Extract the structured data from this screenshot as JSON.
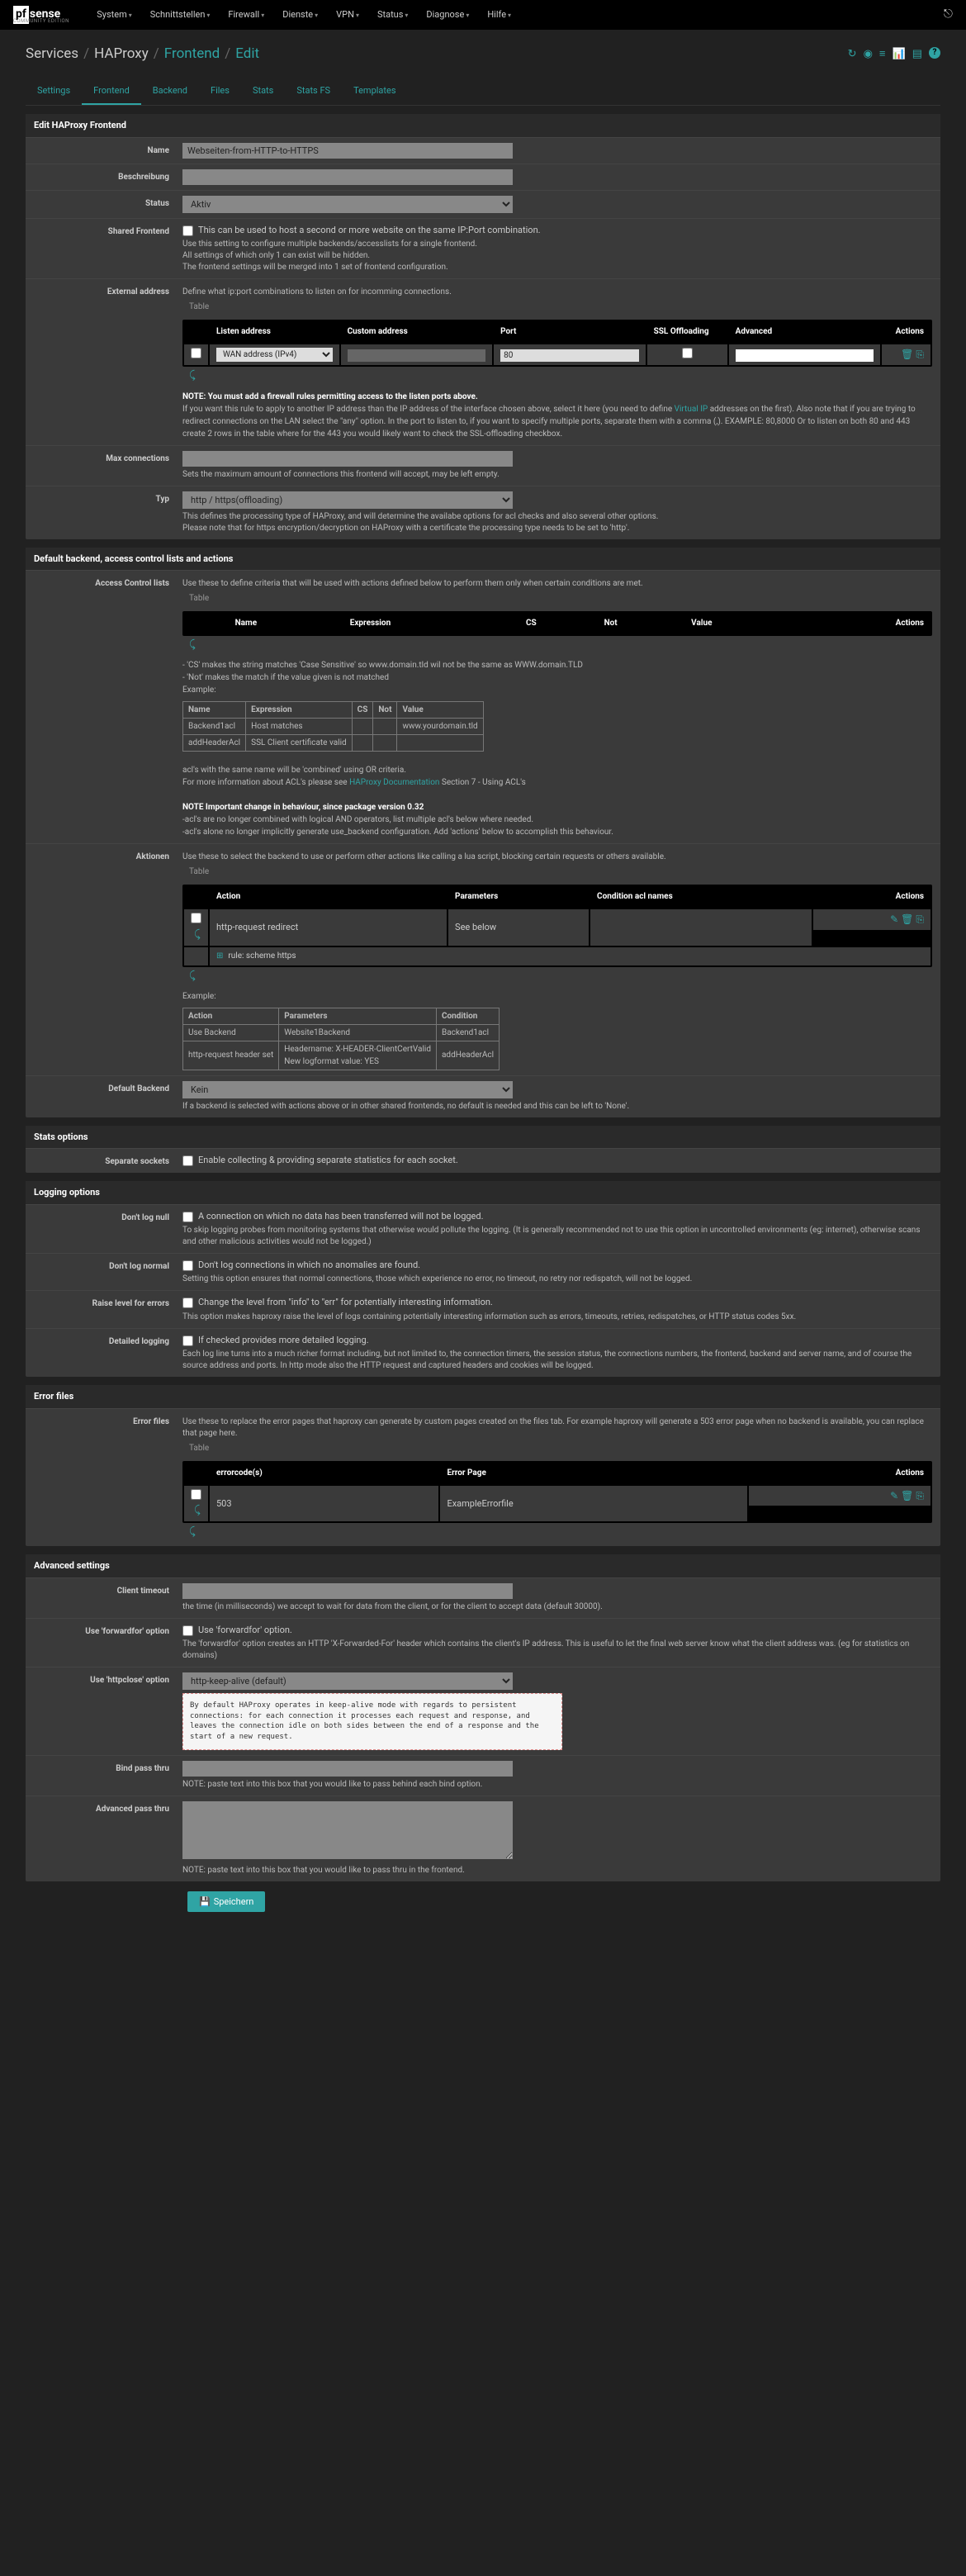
{
  "brand": "sense",
  "comm": "COMMUNITY EDITION",
  "topmenu": [
    "System",
    "Schnittstellen",
    "Firewall",
    "Dienste",
    "VPN",
    "Status",
    "Diagnose",
    "Hilfe"
  ],
  "bc": {
    "s": "Services",
    "h": "HAProxy",
    "f": "Frontend",
    "e": "Edit"
  },
  "tabs": [
    "Settings",
    "Frontend",
    "Backend",
    "Files",
    "Stats",
    "Stats FS",
    "Templates"
  ],
  "p1": {
    "title": "Edit HAProxy Frontend",
    "name": {
      "l": "Name",
      "v": "Webseiten-from-HTTP-to-HTTPS"
    },
    "desc": {
      "l": "Beschreibung",
      "v": ""
    },
    "status": {
      "l": "Status",
      "v": "Aktiv"
    },
    "shared": {
      "l": "Shared Frontend",
      "c": "This can be used to host a second or more website on the same IP:Port combination.",
      "h": "Use this setting to configure multiple backends/accesslists for a single frontend.\nAll settings of which only 1 can exist will be hidden.\nThe frontend settings will be merged into 1 set of frontend configuration."
    },
    "ext": {
      "l": "External address",
      "h1": "Define what ip:port combinations to listen on for incomming connections.",
      "tbl": "Table",
      "th": [
        "Listen address",
        "Custom address",
        "Port",
        "SSL Offloading",
        "Advanced",
        "Actions"
      ],
      "row": {
        "listen": "WAN address (IPv4)",
        "port": "80"
      },
      "note": "NOTE: You must add a firewall rules permitting access to the listen ports above.",
      "note2": "If you want this rule to apply to another IP address than the IP address of the interface chosen above, select it here (you need to define ",
      "vip": "Virtual IP",
      "note3": " addresses on the first). Also note that if you are trying to redirect connections on the LAN select the \"any\" option. In the port to listen to, if you want to specify multiple ports, separate them with a comma (,). EXAMPLE: 80,8000 Or to listen on both 80 and 443 create 2 rows in the table where for the 443 you would likely want to check the SSL-offloading checkbox."
    },
    "max": {
      "l": "Max connections",
      "h": "Sets the maximum amount of connections this frontend will accept, may be left empty."
    },
    "typ": {
      "l": "Typ",
      "v": "http / https(offloading)",
      "h": "This defines the processing type of HAProxy, and will determine the availabe options for acl checks and also several other options.\nPlease note that for https encryption/decryption on HAProxy with a certificate the processing type needs to be set to 'http'."
    }
  },
  "p2": {
    "title": "Default backend, access control lists and actions",
    "acl": {
      "l": "Access Control lists",
      "h1": "Use these to define criteria that will be used with actions defined below to perform them only when certain conditions are met.",
      "tbl": "Table",
      "th": [
        "Name",
        "Expression",
        "CS",
        "Not",
        "Value",
        "Actions"
      ],
      "n1": "- 'CS' makes the string matches 'Case Sensitive' so www.domain.tld wil not be the same as WWW.domain.TLD",
      "n2": "- 'Not' makes the match if the value given is not matched",
      "exl": "Example:",
      "ex": {
        "th": [
          "Name",
          "Expression",
          "CS",
          "Not",
          "Value"
        ],
        "r1": [
          "Backend1acl",
          "Host matches",
          "",
          "",
          "www.yourdomain.tld"
        ],
        "r2": [
          "addHeaderAcl",
          "SSL Client certificate valid",
          "",
          "",
          ""
        ]
      },
      "n3": "acl's with the same name will be 'combined' using OR criteria.",
      "n4": "For more information about ACL's please see ",
      "n4l": "HAProxy Documentation",
      "n4e": " Section 7 - Using ACL's",
      "n5": "NOTE Important change in behaviour, since package version 0.32",
      "n6": "-acl's are no longer combined with logical AND operators, list multiple acl's below where needed.",
      "n7": "-acl's alone no longer implicitly generate use_backend configuration. Add 'actions' below to accomplish this behaviour."
    },
    "akt": {
      "l": "Aktionen",
      "h1": "Use these to select the backend to use or perform other actions like calling a lua script, blocking certain requests or others available.",
      "tbl": "Table",
      "th": [
        "Action",
        "Parameters",
        "Condition acl names",
        "Actions"
      ],
      "row": {
        "action": "http-request redirect",
        "param": "See below",
        "rule": "rule: scheme https"
      },
      "exl": "Example:",
      "ex": {
        "th": [
          "Action",
          "Parameters",
          "Condition"
        ],
        "r1": [
          "Use Backend",
          "Website1Backend",
          "Backend1acl"
        ],
        "r2": [
          "http-request header set",
          "Headername: X-HEADER-ClientCertValid\nNew logformat value: YES",
          "addHeaderAcl"
        ]
      }
    },
    "def": {
      "l": "Default Backend",
      "v": "Kein",
      "h": "If a backend is selected with actions above or in other shared frontends, no default is needed and this can be left to 'None'."
    }
  },
  "p3": {
    "title": "Stats options",
    "sep": {
      "l": "Separate sockets",
      "c": "Enable collecting & providing separate statistics for each socket."
    }
  },
  "p4": {
    "title": "Logging options",
    "null": {
      "l": "Don't log null",
      "c": "A connection on which no data has been transferred will not be logged.",
      "h": "To skip logging probes from monitoring systems that otherwise would pollute the logging. (It is generally recommended not to use this option in uncontrolled environments (eg: internet), otherwise scans and other malicious activities would not be logged.)"
    },
    "norm": {
      "l": "Don't log normal",
      "c": "Don't log connections in which no anomalies are found.",
      "h": "Setting this option ensures that normal connections, those which experience no error, no timeout, no retry nor redispatch, will not be logged."
    },
    "raise": {
      "l": "Raise level for errors",
      "c": "Change the level from \"info\" to \"err\" for potentially interesting information.",
      "h": "This option makes haproxy raise the level of logs containing potentially interesting information such as errors, timeouts, retries, redispatches, or HTTP status codes 5xx."
    },
    "det": {
      "l": "Detailed logging",
      "c": "If checked provides more detailed logging.",
      "h": "Each log line turns into a much richer format including, but not limited to, the connection timers, the session status, the connections numbers, the frontend, backend and server name, and of course the source address and ports. In http mode also the HTTP request and captured headers and cookies will be logged."
    }
  },
  "p5": {
    "title": "Error files",
    "l": "Error files",
    "h1": "Use these to replace the error pages that haproxy can generate by custom pages created on the files tab. For example haproxy will generate a 503 error page when no backend is available, you can replace that page here.",
    "tbl": "Table",
    "th": [
      "errorcode(s)",
      "Error Page",
      "Actions"
    ],
    "row": {
      "code": "503",
      "page": "ExampleErrorfile"
    }
  },
  "p6": {
    "title": "Advanced settings",
    "ct": {
      "l": "Client timeout",
      "h": "the time (in milliseconds) we accept to wait for data from the client, or for the client to accept data (default 30000)."
    },
    "ff": {
      "l": "Use 'forwardfor' option",
      "c": "Use 'forwardfor' option.",
      "h": "The 'forwardfor' option creates an HTTP 'X-Forwarded-For' header which contains the client's IP address. This is useful to let the final web server know what the client address was. (eg for statistics on domains)"
    },
    "hc": {
      "l": "Use 'httpclose' option",
      "v": "http-keep-alive (default)",
      "box": "By default HAProxy operates in keep-alive mode with regards to persistent connections: for each connection it processes each request and response, and leaves the connection idle on both sides between the end of a response and the start of a new request."
    },
    "bp": {
      "l": "Bind pass thru",
      "h": "NOTE: paste text into this box that you would like to pass behind each bind option."
    },
    "ap": {
      "l": "Advanced pass thru",
      "h": "NOTE: paste text into this box that you would like to pass thru in the frontend."
    }
  },
  "save": "Speichern"
}
